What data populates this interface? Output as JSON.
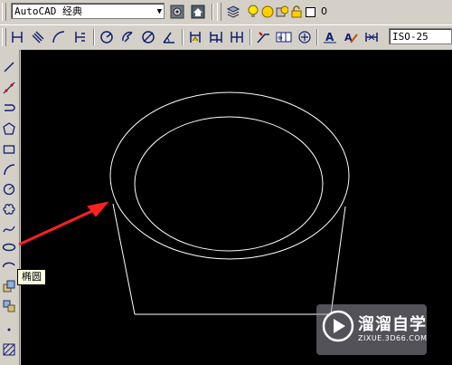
{
  "toolbar": {
    "workspace_combo": "AutoCAD 经典",
    "layer_combo": "0",
    "dimstyle_combo": "ISO-25"
  },
  "tooltip": {
    "text": "椭圆"
  },
  "watermark": {
    "title": "溜溜自学",
    "url": "ZIXUE.3D66.COM"
  },
  "colors": {
    "canvas_background": "#000000",
    "drawing_stroke": "#ffffff",
    "annotation_arrow": "#ff2020",
    "tooltip_background": "#ffffe1",
    "ui_gray": "#d4d0c8"
  }
}
